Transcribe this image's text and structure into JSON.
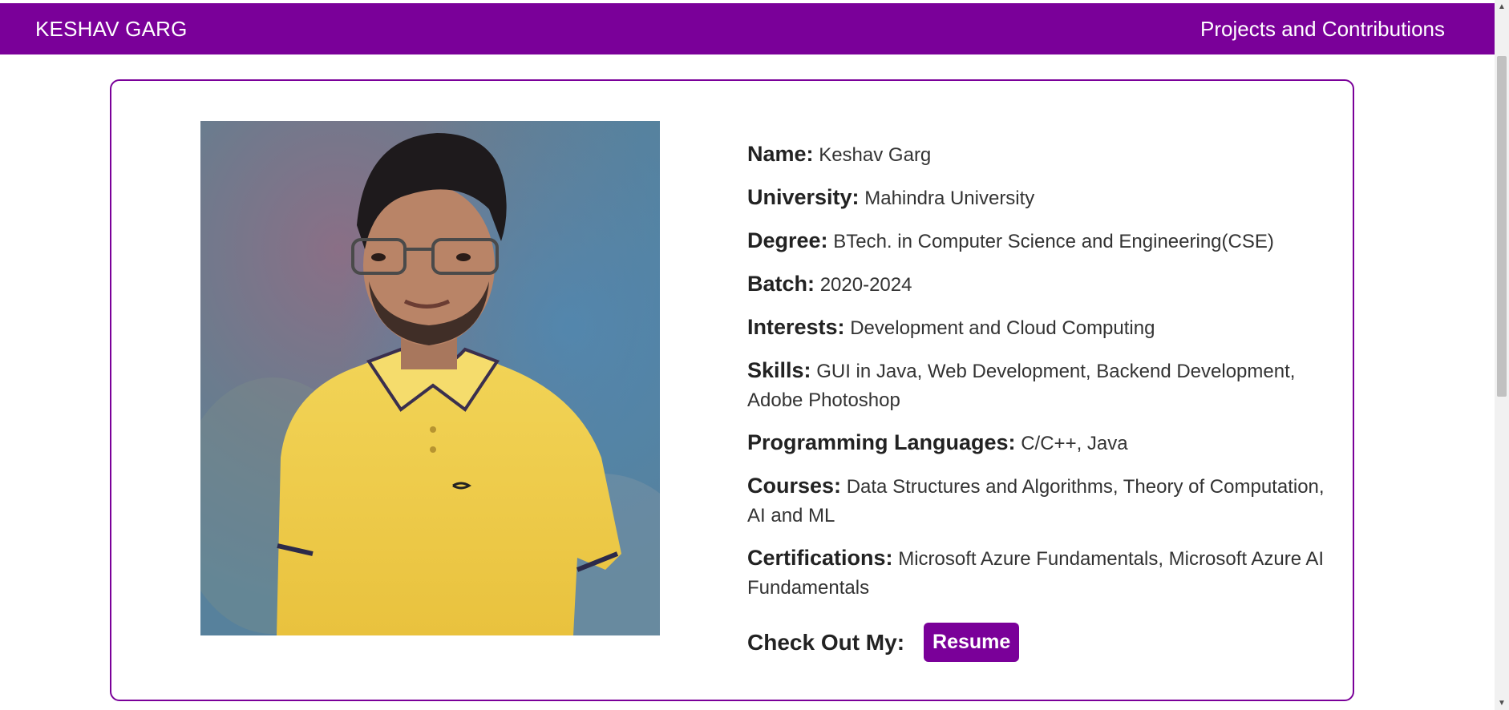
{
  "navbar": {
    "brand": "KESHAV GARG",
    "link": "Projects and Contributions",
    "color": "#7a0099"
  },
  "profile": {
    "photo_alt": "Profile photo of Keshav Garg",
    "fields": [
      {
        "key": "Name:",
        "value": "Keshav Garg"
      },
      {
        "key": "University:",
        "value": "Mahindra University"
      },
      {
        "key": "Degree:",
        "value": "BTech. in Computer Science and Engineering(CSE)"
      },
      {
        "key": "Batch:",
        "value": "2020-2024"
      },
      {
        "key": "Interests:",
        "value": "Development and Cloud Computing"
      },
      {
        "key": "Skills:",
        "value": "GUI in Java, Web Development, Backend Development, Adobe Photoshop"
      },
      {
        "key": "Programming Languages:",
        "value": "C/C++, Java"
      },
      {
        "key": "Courses:",
        "value": "Data Structures and Algorithms, Theory of Computation, AI and ML"
      },
      {
        "key": "Certifications:",
        "value": "Microsoft Azure Fundamentals, Microsoft Azure AI Fundamentals"
      }
    ],
    "cta_label": "Check Out My:",
    "resume_button": "Resume"
  },
  "icons": {
    "scroll_up": "chevron-up-icon",
    "scroll_down": "chevron-down-icon"
  }
}
